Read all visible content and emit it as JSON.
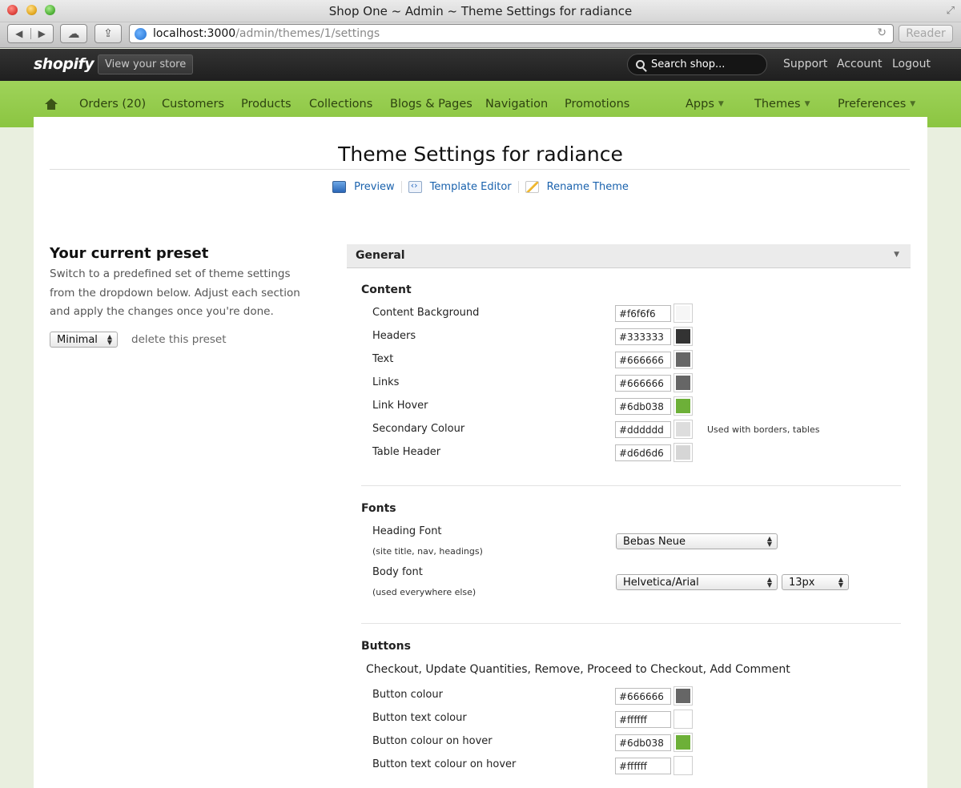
{
  "browser": {
    "window_title": "Shop One ~ Admin ~ Theme Settings for radiance",
    "url_host": "localhost:3000",
    "url_path": "/admin/themes/1/settings",
    "reader_label": "Reader"
  },
  "header": {
    "logo": "shopify",
    "view_store": "View your store",
    "search_placeholder": "Search shop...",
    "links": [
      "Support",
      "Account",
      "Logout"
    ]
  },
  "nav": {
    "items": [
      "Orders (20)",
      "Customers",
      "Products",
      "Collections",
      "Blogs & Pages",
      "Navigation",
      "Promotions"
    ],
    "dropdowns": [
      "Apps",
      "Themes",
      "Preferences"
    ]
  },
  "page": {
    "title": "Theme Settings for radiance",
    "actions": [
      "Preview",
      "Template Editor",
      "Rename Theme"
    ]
  },
  "preset": {
    "title": "Your current preset",
    "description": "Switch to a predefined set of theme settings from the dropdown below. Adjust each section and apply the changes once you're done.",
    "selected": "Minimal",
    "delete_label": "delete this preset"
  },
  "general": {
    "title": "General",
    "content": {
      "title": "Content",
      "rows": [
        {
          "label": "Content Background",
          "value": "#f6f6f6",
          "color": "#f6f6f6"
        },
        {
          "label": "Headers",
          "value": "#333333",
          "color": "#333333"
        },
        {
          "label": "Text",
          "value": "#666666",
          "color": "#666666"
        },
        {
          "label": "Links",
          "value": "#666666",
          "color": "#666666"
        },
        {
          "label": "Link Hover",
          "value": "#6db038",
          "color": "#6db038"
        },
        {
          "label": "Secondary Colour",
          "value": "#dddddd",
          "color": "#dddddd",
          "hint": "Used with borders, tables"
        },
        {
          "label": "Table Header",
          "value": "#d6d6d6",
          "color": "#d6d6d6"
        }
      ]
    },
    "fonts": {
      "title": "Fonts",
      "heading_label": "Heading Font",
      "heading_sub": "(site title, nav, headings)",
      "heading_value": "Bebas Neue",
      "body_label": "Body font",
      "body_sub": "(used everywhere else)",
      "body_value": "Helvetica/Arial",
      "body_size": "13px"
    },
    "buttons": {
      "title": "Buttons",
      "description": "Checkout, Update Quantities, Remove, Proceed to Checkout, Add Comment",
      "rows": [
        {
          "label": "Button colour",
          "value": "#666666",
          "color": "#666666"
        },
        {
          "label": "Button text colour",
          "value": "#ffffff",
          "color": "#ffffff"
        },
        {
          "label": "Button colour on hover",
          "value": "#6db038",
          "color": "#6db038"
        },
        {
          "label": "Button text colour on hover",
          "value": "#ffffff",
          "color": "#ffffff"
        }
      ]
    }
  }
}
